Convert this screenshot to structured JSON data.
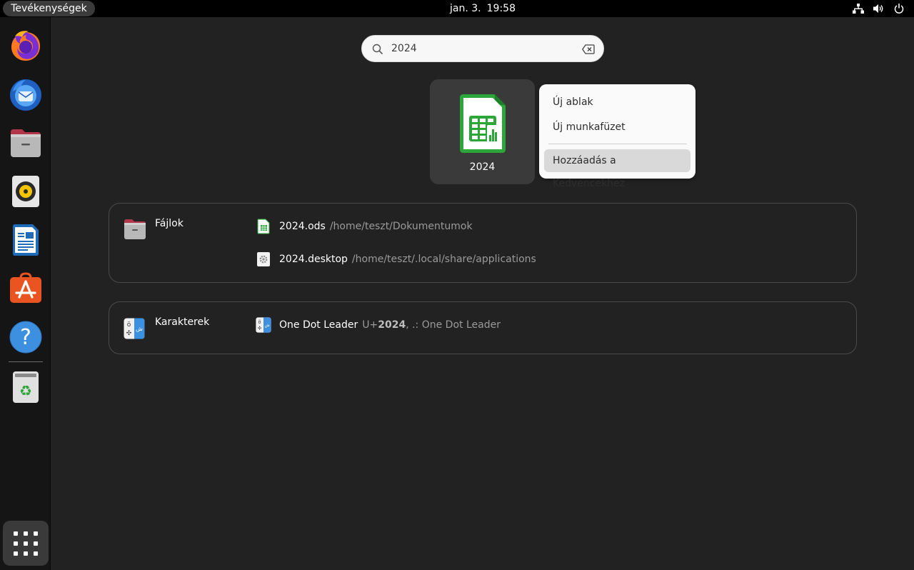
{
  "topbar": {
    "activities_label": "Tevékenységek",
    "date": "jan. 3.",
    "time": "19:58",
    "tray_icons": [
      "network-icon",
      "volume-icon",
      "power-icon"
    ]
  },
  "dock": {
    "items": [
      {
        "name": "firefox-icon"
      },
      {
        "name": "thunderbird-icon"
      },
      {
        "name": "files-icon"
      },
      {
        "name": "rhythmbox-icon"
      },
      {
        "name": "libreoffice-writer-icon"
      },
      {
        "name": "app-center-icon"
      },
      {
        "name": "help-icon"
      },
      {
        "name": "trash-icon"
      }
    ],
    "show_apps_icon": "apps-grid-icon"
  },
  "search": {
    "value": "2024"
  },
  "app_result": {
    "label": "2024"
  },
  "context_menu": {
    "items": [
      "Új ablak",
      "Új munkafüzet"
    ],
    "highlighted_item": "Hozzáadás a Kedvencekhez"
  },
  "files_panel": {
    "title": "Fájlok",
    "results": [
      {
        "name": "2024.ods",
        "path": "/home/teszt/Dokumentumok"
      },
      {
        "name": "2024.desktop",
        "path": "/home/teszt/.local/share/applications"
      }
    ]
  },
  "chars_panel": {
    "title": "Karakterek",
    "result_name": "One Dot Leader",
    "code_prefix": "U+",
    "code_value": "2024",
    "code_suffix": ", .: One Dot Leader"
  },
  "colors": {
    "accent_green": "#2ca539",
    "dock_bg": "#151515",
    "overview_bg": "#222222"
  }
}
